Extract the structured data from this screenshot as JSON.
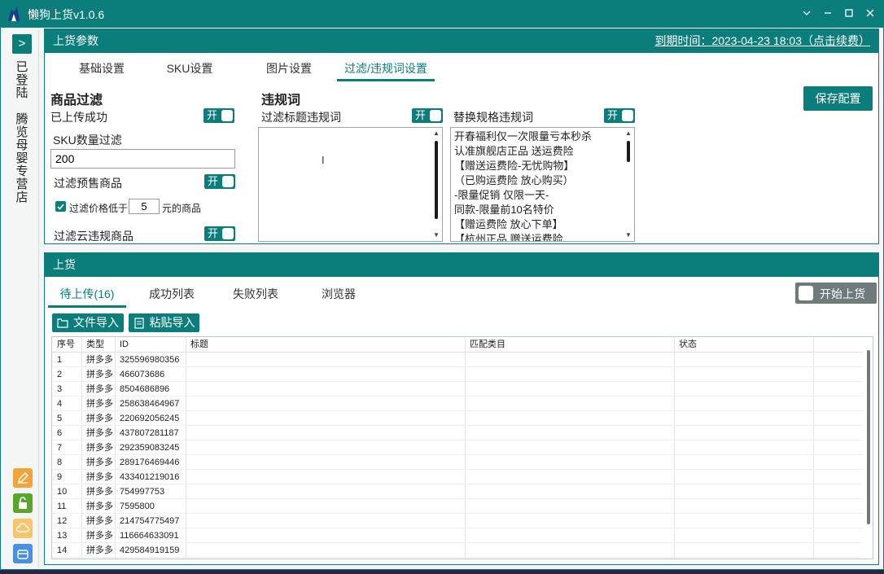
{
  "window": {
    "title": "懒狗上货v1.0.6"
  },
  "sidebar": {
    "toggle_label": ">",
    "login_status": "已登陆",
    "shop_name": "腾览母婴专营店"
  },
  "params": {
    "header": "上货参数",
    "expire_text": "到期时间：2023-04-23 18:03（点击续费）",
    "tabs": [
      {
        "label": "基础设置"
      },
      {
        "label": "SKU设置"
      },
      {
        "label": "图片设置"
      },
      {
        "label": "过滤/违规词设置",
        "active": true
      }
    ],
    "filter": {
      "heading": "商品过滤",
      "uploaded_label": "已上传成功",
      "sku_count_label": "SKU数量过滤",
      "sku_count_value": "200",
      "presale_label": "过滤预售商品",
      "price_check_label": "过滤价格低于",
      "price_value": "5",
      "price_suffix": "元的商品",
      "cloud_label": "过滤云违规商品",
      "switch_on": "开"
    },
    "violation": {
      "heading": "违规词",
      "title_words_label": "过滤标题违规词",
      "spec_words_label": "替换规格违规词",
      "spec_words_lines": [
        "开春福利仅一次限量亏本秒杀",
        "认准旗舰店正品 送运费险",
        "【赠送运费险-无忧购物】",
        "（已购运费险 放心购买）",
        "-限量促销 仅限一天-",
        "同款-限量前10名特价",
        "【赠运费险 放心下单】",
        "【杭州正品 赠送运费险"
      ]
    },
    "save_button": "保存配置"
  },
  "upload": {
    "header": "上货",
    "tabs": [
      {
        "label": "待上传(16)",
        "active": true
      },
      {
        "label": "成功列表"
      },
      {
        "label": "失败列表"
      },
      {
        "label": "浏览器"
      }
    ],
    "start_button": "开始上货",
    "file_import": "文件导入",
    "paste_import": "粘贴导入",
    "columns": [
      "序号",
      "类型",
      "ID",
      "标题",
      "匹配类目",
      "状态"
    ],
    "rows": [
      [
        "1",
        "拼多多",
        "325596980356"
      ],
      [
        "2",
        "拼多多",
        "466073686"
      ],
      [
        "3",
        "拼多多",
        "8504686896"
      ],
      [
        "4",
        "拼多多",
        "258638464967"
      ],
      [
        "5",
        "拼多多",
        "220692056245"
      ],
      [
        "6",
        "拼多多",
        "437807281187"
      ],
      [
        "7",
        "拼多多",
        "292359083245"
      ],
      [
        "8",
        "拼多多",
        "289176469446"
      ],
      [
        "9",
        "拼多多",
        "433401219016"
      ],
      [
        "10",
        "拼多多",
        "754997753"
      ],
      [
        "11",
        "拼多多",
        "7595800"
      ],
      [
        "12",
        "拼多多",
        "214754775497"
      ],
      [
        "13",
        "拼多多",
        "116664633091"
      ],
      [
        "14",
        "拼多多",
        "429584919159"
      ]
    ]
  },
  "colors": {
    "accent": "#0b7d7b",
    "orange": "#f0a43a",
    "green": "#5aa52b",
    "blue": "#4a8fe0"
  }
}
